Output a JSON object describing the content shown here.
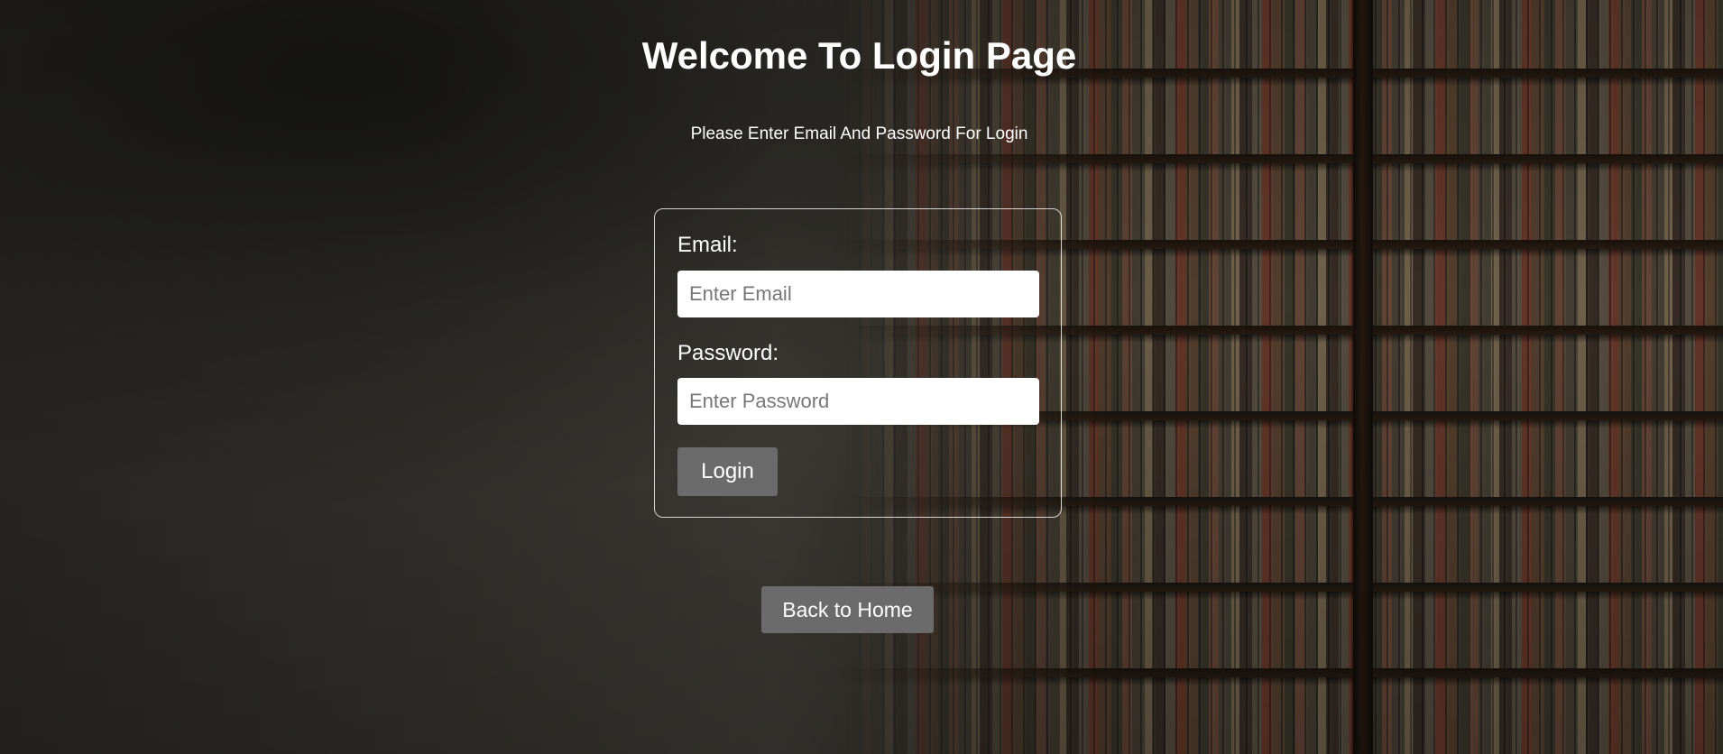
{
  "header": {
    "title": "Welcome To Login Page",
    "subtitle": "Please Enter Email And Password For Login"
  },
  "login_form": {
    "email_label": "Email:",
    "email_placeholder": "Enter Email",
    "email_value": "",
    "password_label": "Password:",
    "password_placeholder": "Enter Password",
    "password_value": "",
    "submit_label": "Login"
  },
  "navigation": {
    "back_label": "Back to Home"
  },
  "colors": {
    "button_background": "#6b6b6b",
    "text": "#ffffff",
    "form_border": "#cccccc"
  }
}
